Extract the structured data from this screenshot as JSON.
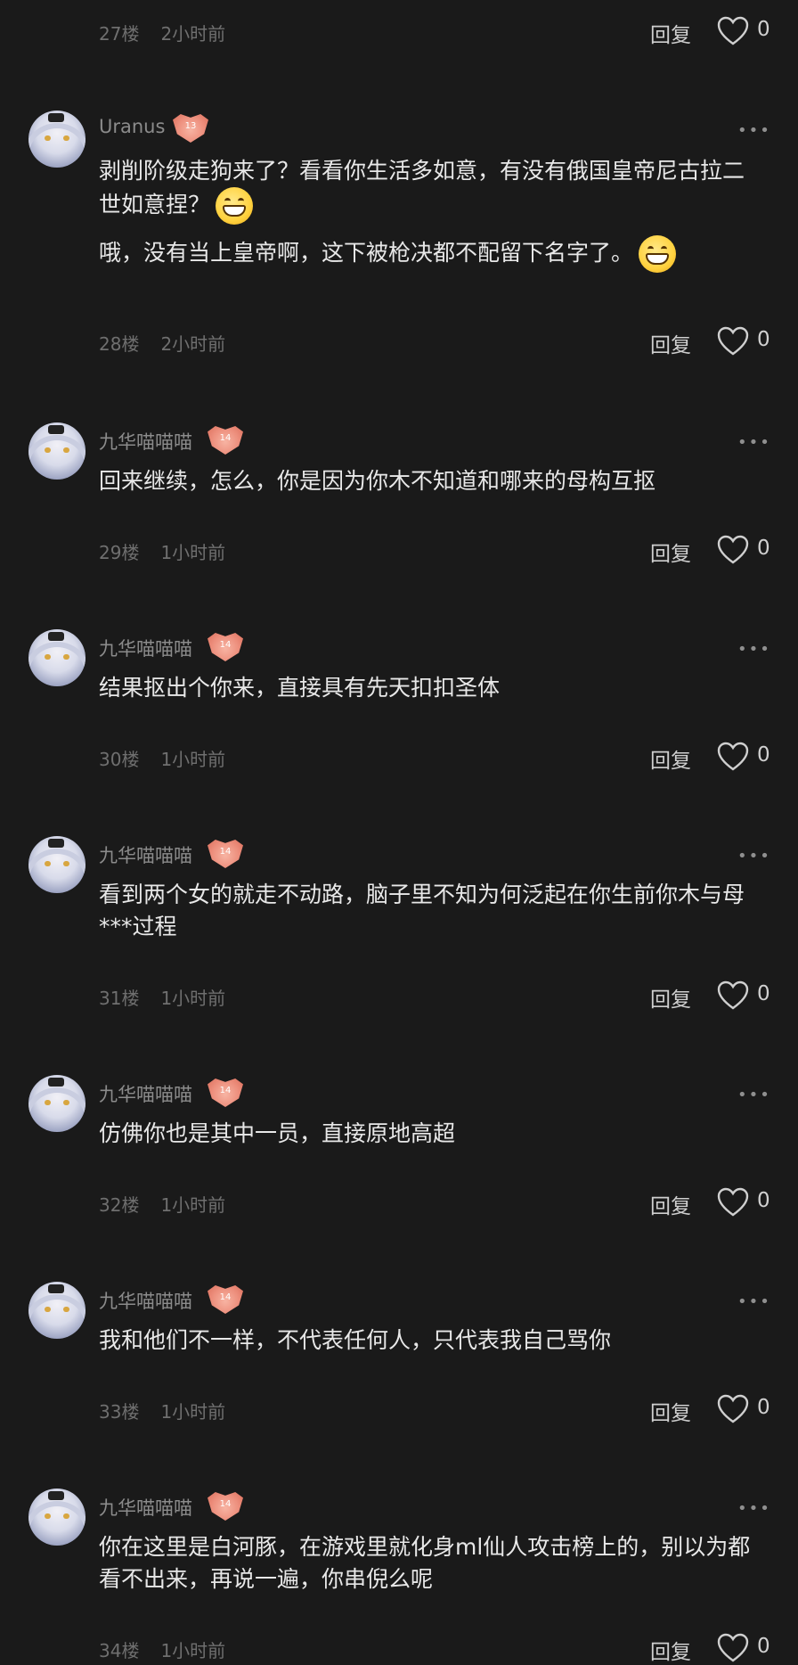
{
  "actions": {
    "reply": "回复",
    "more": "•••"
  },
  "top_row": {
    "floor": "27楼",
    "time": "2小时前",
    "likes": "0"
  },
  "comments": [
    {
      "user": "Uranus",
      "level": "13",
      "floor": "28楼",
      "time": "2小时前",
      "likes": "0",
      "lines": [
        "剥削阶级走狗来了？看看你生活多如意，有没有俄国皇帝尼古拉二世如意捏？",
        "哦，没有当上皇帝啊，这下被枪决都不配留下名字了。"
      ]
    },
    {
      "user": "九华喵喵喵",
      "level": "14",
      "floor": "29楼",
      "time": "1小时前",
      "likes": "0",
      "lines": [
        "回来继续，怎么，你是因为你木不知道和哪来的母构互抠"
      ]
    },
    {
      "user": "九华喵喵喵",
      "level": "14",
      "floor": "30楼",
      "time": "1小时前",
      "likes": "0",
      "lines": [
        "结果抠出个你来，直接具有先天扣扣圣体"
      ]
    },
    {
      "user": "九华喵喵喵",
      "level": "14",
      "floor": "31楼",
      "time": "1小时前",
      "likes": "0",
      "lines": [
        "看到两个女的就走不动路，脑子里不知为何泛起在你生前你木与母***过程"
      ]
    },
    {
      "user": "九华喵喵喵",
      "level": "14",
      "floor": "32楼",
      "time": "1小时前",
      "likes": "0",
      "lines": [
        "仿佛你也是其中一员，直接原地高超"
      ]
    },
    {
      "user": "九华喵喵喵",
      "level": "14",
      "floor": "33楼",
      "time": "1小时前",
      "likes": "0",
      "lines": [
        "我和他们不一样，不代表任何人，只代表我自己骂你"
      ]
    },
    {
      "user": "九华喵喵喵",
      "level": "14",
      "floor": "34楼",
      "time": "1小时前",
      "likes": "0",
      "lines": [
        "你在这里是白河豚，在游戏里就化身ml仙人攻击榜上的，别以为都看不出来，再说一遍，你串倪么呢"
      ]
    }
  ]
}
